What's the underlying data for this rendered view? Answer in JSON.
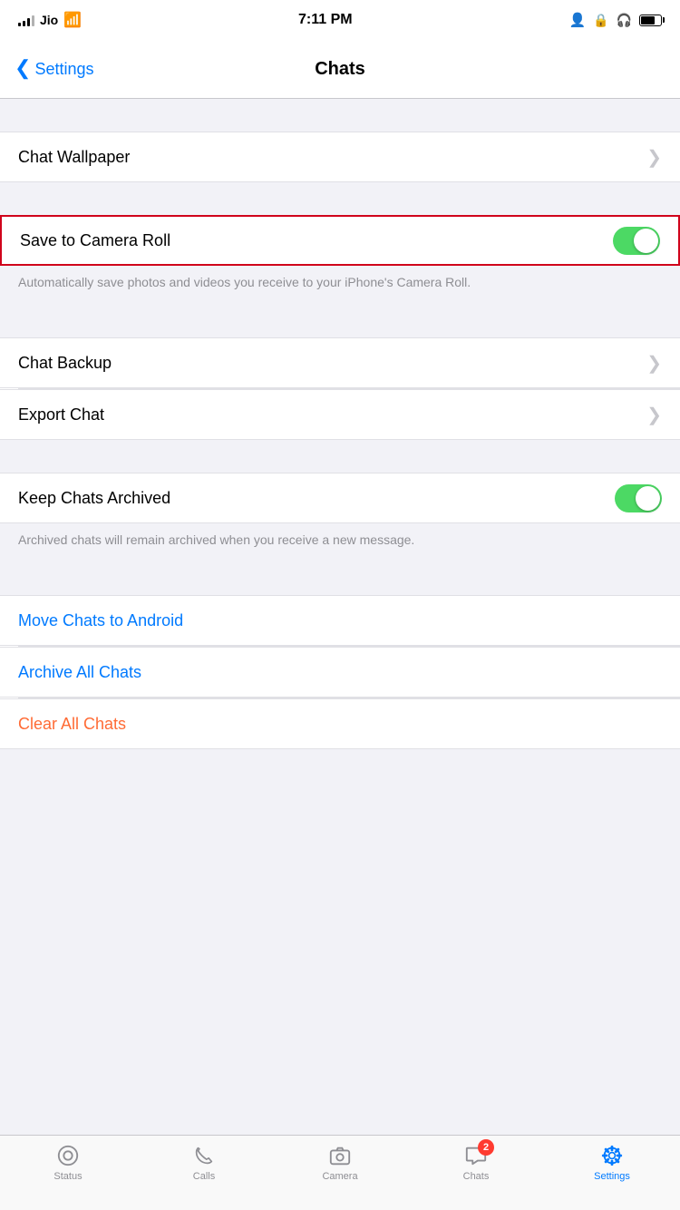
{
  "statusBar": {
    "carrier": "Jio",
    "time": "7:11 PM"
  },
  "navBar": {
    "backLabel": "Settings",
    "title": "Chats"
  },
  "sections": [
    {
      "id": "wallpaper",
      "cells": [
        {
          "id": "chat-wallpaper",
          "label": "Chat Wallpaper",
          "type": "chevron"
        }
      ]
    },
    {
      "id": "camera-roll",
      "cells": [
        {
          "id": "save-camera-roll",
          "label": "Save to Camera Roll",
          "type": "toggle",
          "toggleOn": true,
          "highlighted": true
        }
      ],
      "description": "Automatically save photos and videos you receive to your iPhone's Camera Roll."
    },
    {
      "id": "backup-export",
      "cells": [
        {
          "id": "chat-backup",
          "label": "Chat Backup",
          "type": "chevron"
        },
        {
          "id": "export-chat",
          "label": "Export Chat",
          "type": "chevron"
        }
      ]
    },
    {
      "id": "archive",
      "cells": [
        {
          "id": "keep-chats-archived",
          "label": "Keep Chats Archived",
          "type": "toggle",
          "toggleOn": true
        }
      ],
      "description": "Archived chats will remain archived when you receive a new message."
    },
    {
      "id": "actions",
      "cells": [
        {
          "id": "move-chats-android",
          "label": "Move Chats to Android",
          "type": "blue-action"
        },
        {
          "id": "archive-all-chats",
          "label": "Archive All Chats",
          "type": "blue-action"
        },
        {
          "id": "clear-all-chats",
          "label": "Clear All Chats",
          "type": "orange-action"
        }
      ]
    }
  ],
  "tabBar": {
    "items": [
      {
        "id": "status",
        "label": "Status",
        "active": false
      },
      {
        "id": "calls",
        "label": "Calls",
        "active": false
      },
      {
        "id": "camera",
        "label": "Camera",
        "active": false
      },
      {
        "id": "chats",
        "label": "Chats",
        "active": false,
        "badge": "2"
      },
      {
        "id": "settings",
        "label": "Settings",
        "active": true
      }
    ]
  }
}
